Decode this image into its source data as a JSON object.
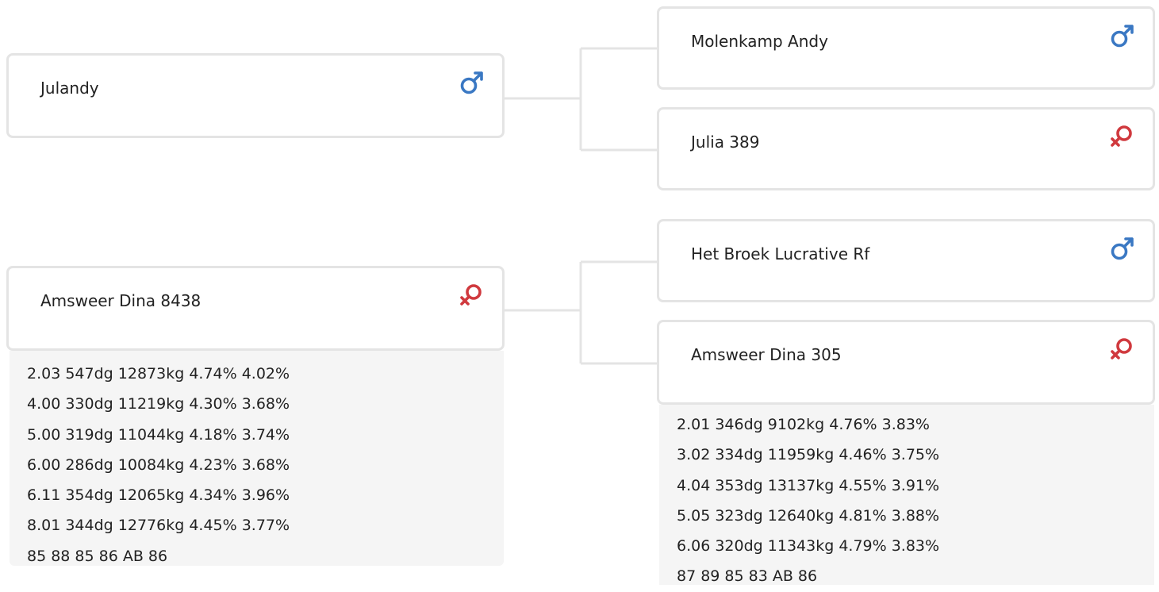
{
  "pedigree": {
    "subject_sire": {
      "name": "Julandy",
      "sex": "male",
      "sex_icon": "male-symbol-icon",
      "sire": {
        "name": "Molenkamp Andy",
        "sex": "male",
        "sex_icon": "male-symbol-icon"
      },
      "dam": {
        "name": "Julia 389",
        "sex": "female",
        "sex_icon": "female-symbol-icon"
      }
    },
    "subject_dam": {
      "name": "Amsweer Dina 8438",
      "sex": "female",
      "sex_icon": "female-symbol-icon",
      "stats": [
        "2.03 547dg 12873kg 4.74% 4.02%",
        "4.00 330dg 11219kg 4.30% 3.68%",
        "5.00 319dg 11044kg 4.18% 3.74%",
        "6.00 286dg 10084kg 4.23% 3.68%",
        "6.11 354dg 12065kg 4.34% 3.96%",
        "8.01 344dg 12776kg 4.45% 3.77%",
        "85 88 85 86 AB 86"
      ],
      "sire": {
        "name": "Het Broek Lucrative Rf",
        "sex": "male",
        "sex_icon": "male-symbol-icon"
      },
      "dam": {
        "name": "Amsweer Dina 305",
        "sex": "female",
        "sex_icon": "female-symbol-icon",
        "stats": [
          "2.01 346dg 9102kg 4.76% 3.83%",
          "3.02 334dg 11959kg 4.46% 3.75%",
          "4.04 353dg 13137kg 4.55% 3.91%",
          "5.05 323dg 12640kg 4.81% 3.88%",
          "6.06 320dg 11343kg 4.79% 3.83%",
          "87 89 85 83 AB 86"
        ]
      }
    }
  },
  "colors": {
    "male": "#3a78c3",
    "female": "#d0393e",
    "border": "#e4e4e4",
    "connector": "#e4e4e4",
    "stats_bg": "#f5f5f5"
  }
}
